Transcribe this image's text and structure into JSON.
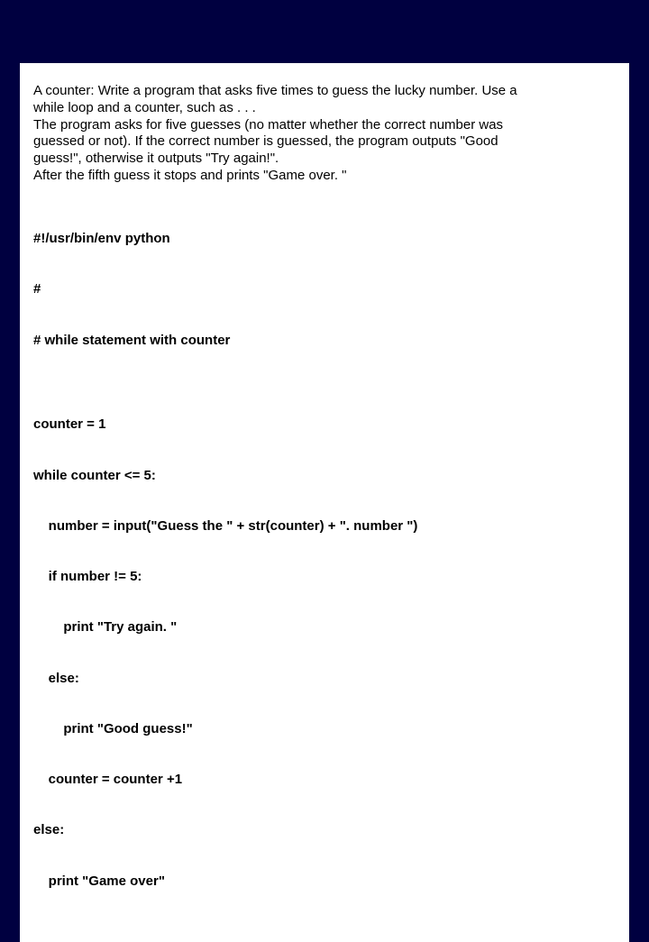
{
  "prose": [
    "A counter: Write a program that asks five times to guess the lucky number. Use a",
    "while loop and a counter, such as . . .",
    "The program asks for five guesses (no matter whether the correct number was",
    "guessed or not). If the correct number is guessed, the program outputs \"Good",
    "guess!\", otherwise it outputs \"Try again!\".",
    "After the fifth guess it stops and prints \"Game over. \""
  ],
  "code": [
    "#!/usr/bin/env python",
    "#",
    "# while statement with counter",
    "",
    "counter = 1",
    "while counter <= 5:",
    "    number = input(\"Guess the \" + str(counter) + \". number \")",
    "    if number != 5:",
    "        print \"Try again. \"",
    "    else:",
    "        print \"Good guess!\"",
    "    counter = counter +1",
    "else:",
    "    print \"Game over\""
  ]
}
